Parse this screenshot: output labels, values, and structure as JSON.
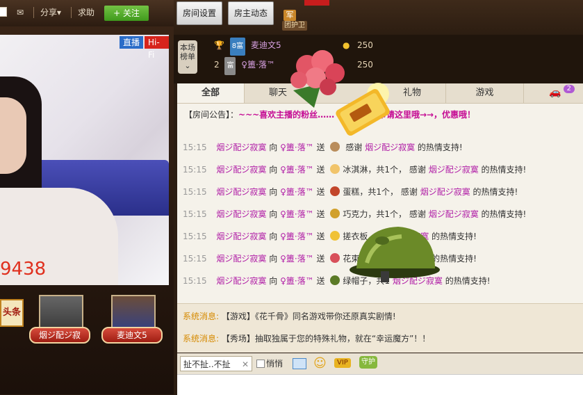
{
  "topbar": {
    "share_label": "分享",
    "help_label": "求助",
    "follow_label": "+ 关注"
  },
  "video": {
    "badge_live": "直播",
    "badge_hifi": "Hi-Fi",
    "counter": "9438"
  },
  "headline_sign": "头条",
  "avatars": [
    {
      "name": "烟ジ配ジ寂"
    },
    {
      "name": "麦迪文5"
    }
  ],
  "room_top": {
    "settings_label": "房间设置",
    "dynamics_label": "房主动态",
    "guard_icon_text": "军",
    "guard_label": "团护卫"
  },
  "rank": {
    "label": "本场榜单",
    "rows": [
      {
        "rank": "8",
        "level": "8富",
        "name": "麦迪文5",
        "score": "250"
      },
      {
        "rank": "2",
        "level": "富",
        "name": "♀簠·落™",
        "score": "250"
      }
    ]
  },
  "tabs": [
    {
      "label": "全部"
    },
    {
      "label": "聊天"
    },
    {
      "label": "礼物"
    },
    {
      "label": "游戏"
    }
  ],
  "cart_badge": "2",
  "announcement": {
    "prefix": "【房间公告】：",
    "text": "~~~喜欢主播的粉丝……",
    "text2": "榴♡币请这里哦→→，优惠哦！"
  },
  "messages": [
    {
      "time": "15:15",
      "from": "烟ジ配ジ寂寞",
      "verb": "向",
      "to": "♀簠·落™",
      "action": "送",
      "gift": "",
      "tail": "感谢",
      "thanks_user": "烟ジ配ジ寂寞",
      "end": "的热情支持!",
      "color": "#b98d5c"
    },
    {
      "time": "15:15",
      "from": "烟ジ配ジ寂寞",
      "verb": "向",
      "to": "♀簠·落™",
      "action": "送",
      "gift": "冰淇淋，共1个，",
      "tail": "感谢",
      "thanks_user": "烟ジ配ジ寂寞",
      "end": "的热情支持!",
      "color": "#f1c46a"
    },
    {
      "time": "15:15",
      "from": "烟ジ配ジ寂寞",
      "verb": "向",
      "to": "♀簠·落™",
      "action": "送",
      "gift": "蛋糕，共1个，",
      "tail": "感谢",
      "thanks_user": "烟ジ配ジ寂寞",
      "end": "的热情支持!",
      "color": "#c2462b"
    },
    {
      "time": "15:15",
      "from": "烟ジ配ジ寂寞",
      "verb": "向",
      "to": "♀簠·落™",
      "action": "送",
      "gift": "巧克力，共1个，",
      "tail": "感谢",
      "thanks_user": "烟ジ配ジ寂寞",
      "end": "的热情支持!",
      "color": "#d1a02c"
    },
    {
      "time": "15:15",
      "from": "烟ジ配ジ寂寞",
      "verb": "向",
      "to": "♀簠·落™",
      "action": "送",
      "gift": "搓衣板，",
      "tail": "",
      "thanks_user": "烟ジ配ジ寂寞",
      "end": "的热情支持!",
      "color": "#f0c237"
    },
    {
      "time": "15:15",
      "from": "烟ジ配ジ寂寞",
      "verb": "向",
      "to": "♀簠·落™",
      "action": "送",
      "gift": "花束，共",
      "tail": "",
      "thanks_user": "烟ジ配ジ寂寞",
      "end": "的热情支持!",
      "color": "#d8505a"
    },
    {
      "time": "15:15",
      "from": "烟ジ配ジ寂寞",
      "verb": "向",
      "to": "♀簠·落™",
      "action": "送",
      "gift": "绿帽子，共1",
      "tail": "",
      "thanks_user": "烟ジ配ジ寂寞",
      "end": "的热情支持!",
      "color": "#5b7a26"
    }
  ],
  "system": [
    {
      "tag": "系统消息:",
      "text": "【游戏】《花千骨》同名游戏带你还原真实剧情!"
    },
    {
      "tag": "系统消息:",
      "text": "【秀场】抽取独属于您的特殊礼物，就在“幸运魔方”！！"
    }
  ],
  "input": {
    "target": "扯不扯..不扯",
    "whisper_label": "悄悄",
    "vip_label": "VIP",
    "guard_label": "守护"
  }
}
